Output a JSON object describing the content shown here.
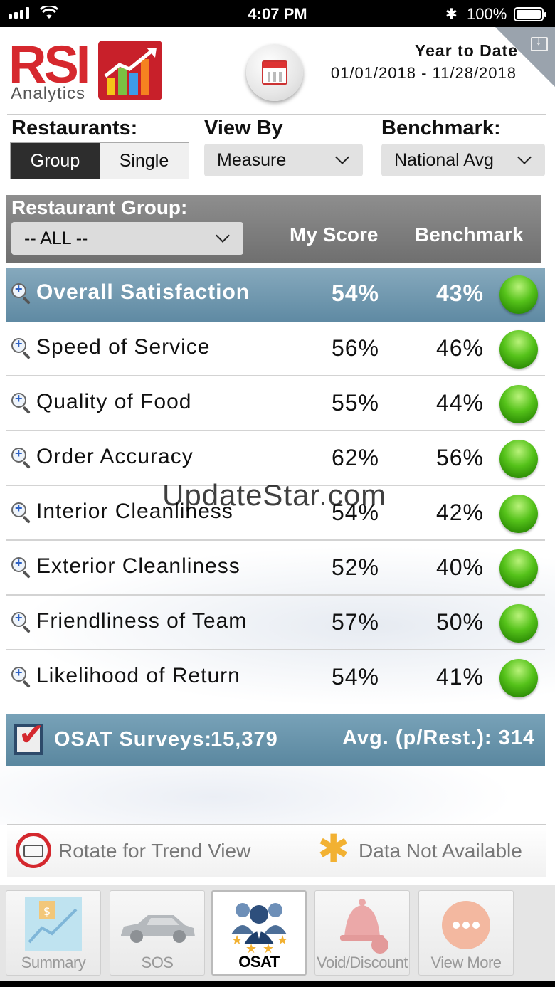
{
  "status_bar": {
    "time": "4:07 PM",
    "battery": "100%"
  },
  "header": {
    "logo_text": "RSI",
    "logo_sub": "Analytics",
    "period_title": "Year to Date",
    "period_range": "01/01/2018 - 11/28/2018"
  },
  "controls": {
    "restaurants_label": "Restaurants:",
    "restaurants_options": [
      "Group",
      "Single"
    ],
    "restaurants_selected": "Group",
    "view_by_label": "View By",
    "view_by_value": "Measure",
    "benchmark_label": "Benchmark:",
    "benchmark_value": "National Avg"
  },
  "group_header": {
    "title": "Restaurant Group:",
    "group_value": "-- ALL --",
    "col_my_score": "My Score",
    "col_benchmark": "Benchmark"
  },
  "rows": [
    {
      "name": "Overall Satisfaction",
      "score": "54%",
      "benchmark": "43%",
      "status_color": "#4cbf16"
    },
    {
      "name": "Speed of Service",
      "score": "56%",
      "benchmark": "46%",
      "status_color": "#4cbf16"
    },
    {
      "name": "Quality of Food",
      "score": "55%",
      "benchmark": "44%",
      "status_color": "#4cbf16"
    },
    {
      "name": "Order Accuracy",
      "score": "62%",
      "benchmark": "56%",
      "status_color": "#4cbf16"
    },
    {
      "name": "Interior Cleanliness",
      "score": "54%",
      "benchmark": "42%",
      "status_color": "#4cbf16"
    },
    {
      "name": "Exterior Cleanliness",
      "score": "52%",
      "benchmark": "40%",
      "status_color": "#4cbf16"
    },
    {
      "name": "Friendliness of Team",
      "score": "57%",
      "benchmark": "50%",
      "status_color": "#4cbf16"
    },
    {
      "name": "Likelihood of Return",
      "score": "54%",
      "benchmark": "41%",
      "status_color": "#4cbf16"
    }
  ],
  "surveys": {
    "label": "OSAT Surveys:",
    "count": "15,379",
    "avg": "Avg. (p/Rest.): 314"
  },
  "legend": {
    "rotate": "Rotate for Trend View",
    "not_available": "Data Not Available"
  },
  "tabs": [
    {
      "label": "Summary",
      "icon": "summary-chart-icon"
    },
    {
      "label": "SOS",
      "icon": "car-icon"
    },
    {
      "label": "OSAT",
      "icon": "people-stars-icon"
    },
    {
      "label": "Void/Discount",
      "icon": "bell-icon"
    },
    {
      "label": "View More",
      "icon": "more-icon"
    }
  ],
  "active_tab": "OSAT",
  "watermark": "UpdateStar.com",
  "colors": {
    "brand_red": "#d6282e",
    "accent_blue": "#5f8aa3",
    "status_green": "#4cbf16"
  }
}
